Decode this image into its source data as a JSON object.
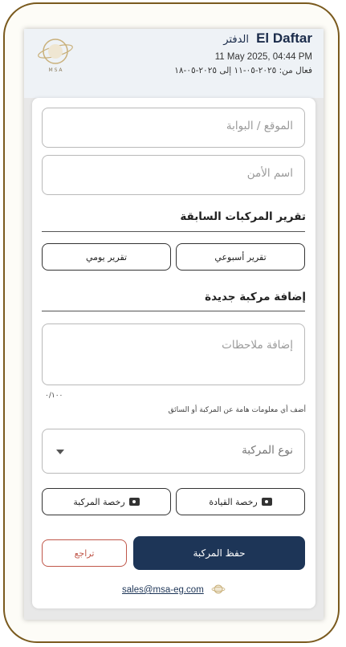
{
  "header": {
    "title_en": "El Daftar",
    "title_ar": "الدفتر",
    "date": "11 May 2025, 04:44 PM",
    "active_range": "فعال من: ٢٠٢٥-٠٥-١١ إلى ٢٠٢٥-٠٥-١٨",
    "logo_text": "M S A"
  },
  "form": {
    "location_placeholder": "الموقع / البوابة",
    "guard_placeholder": "اسم الأمن",
    "prev_reports_title": "تقرير المركبات السابقة",
    "weekly_report_label": "تقرير أسبوعي",
    "daily_report_label": "تقرير يومي",
    "add_vehicle_title": "إضافة مركبة جديدة",
    "notes_placeholder": "إضافة ملاحظات",
    "notes_counter": "٠/١٠٠",
    "notes_hint": "أضف أي معلومات هامة عن المركبة أو السائق",
    "vehicle_type_label": "نوع المركبة",
    "driving_license_label": "رخصة القيادة",
    "vehicle_license_label": "رخصة المركبة",
    "save_label": "حفظ المركبة",
    "back_label": "تراجع"
  },
  "footer": {
    "email": "sales@msa-eg.com"
  },
  "colors": {
    "primary": "#1d3557",
    "danger": "#c0574a",
    "frame": "#7a5a1e"
  }
}
